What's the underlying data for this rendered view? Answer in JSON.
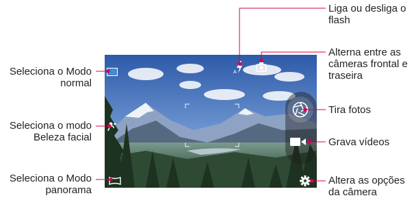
{
  "callouts": {
    "flash": "Liga ou desliga o\nflash",
    "switch_camera": "Alterna entre as\ncâmeras frontal e\ntraseira",
    "normal_mode": "Seleciona o Modo\nnormal",
    "take_photo": "Tira fotos",
    "beauty_mode": "Seleciona o modo\nBeleza facial",
    "record_video": "Grava vídeos",
    "panorama_mode": "Seleciona o Modo\npanorama",
    "camera_options": "Altera as opções\nda câmera"
  },
  "icons": {
    "normal_mode": "photo-mode-icon",
    "flash": "flash-auto-icon",
    "switch_camera": "switch-camera-icon",
    "beauty": "beauty-face-icon",
    "shutter": "aperture-shutter-icon",
    "video": "video-camera-icon",
    "panorama": "panorama-icon",
    "settings": "gear-icon"
  },
  "colors": {
    "callout_line": "#d7004c",
    "text": "#222222"
  }
}
